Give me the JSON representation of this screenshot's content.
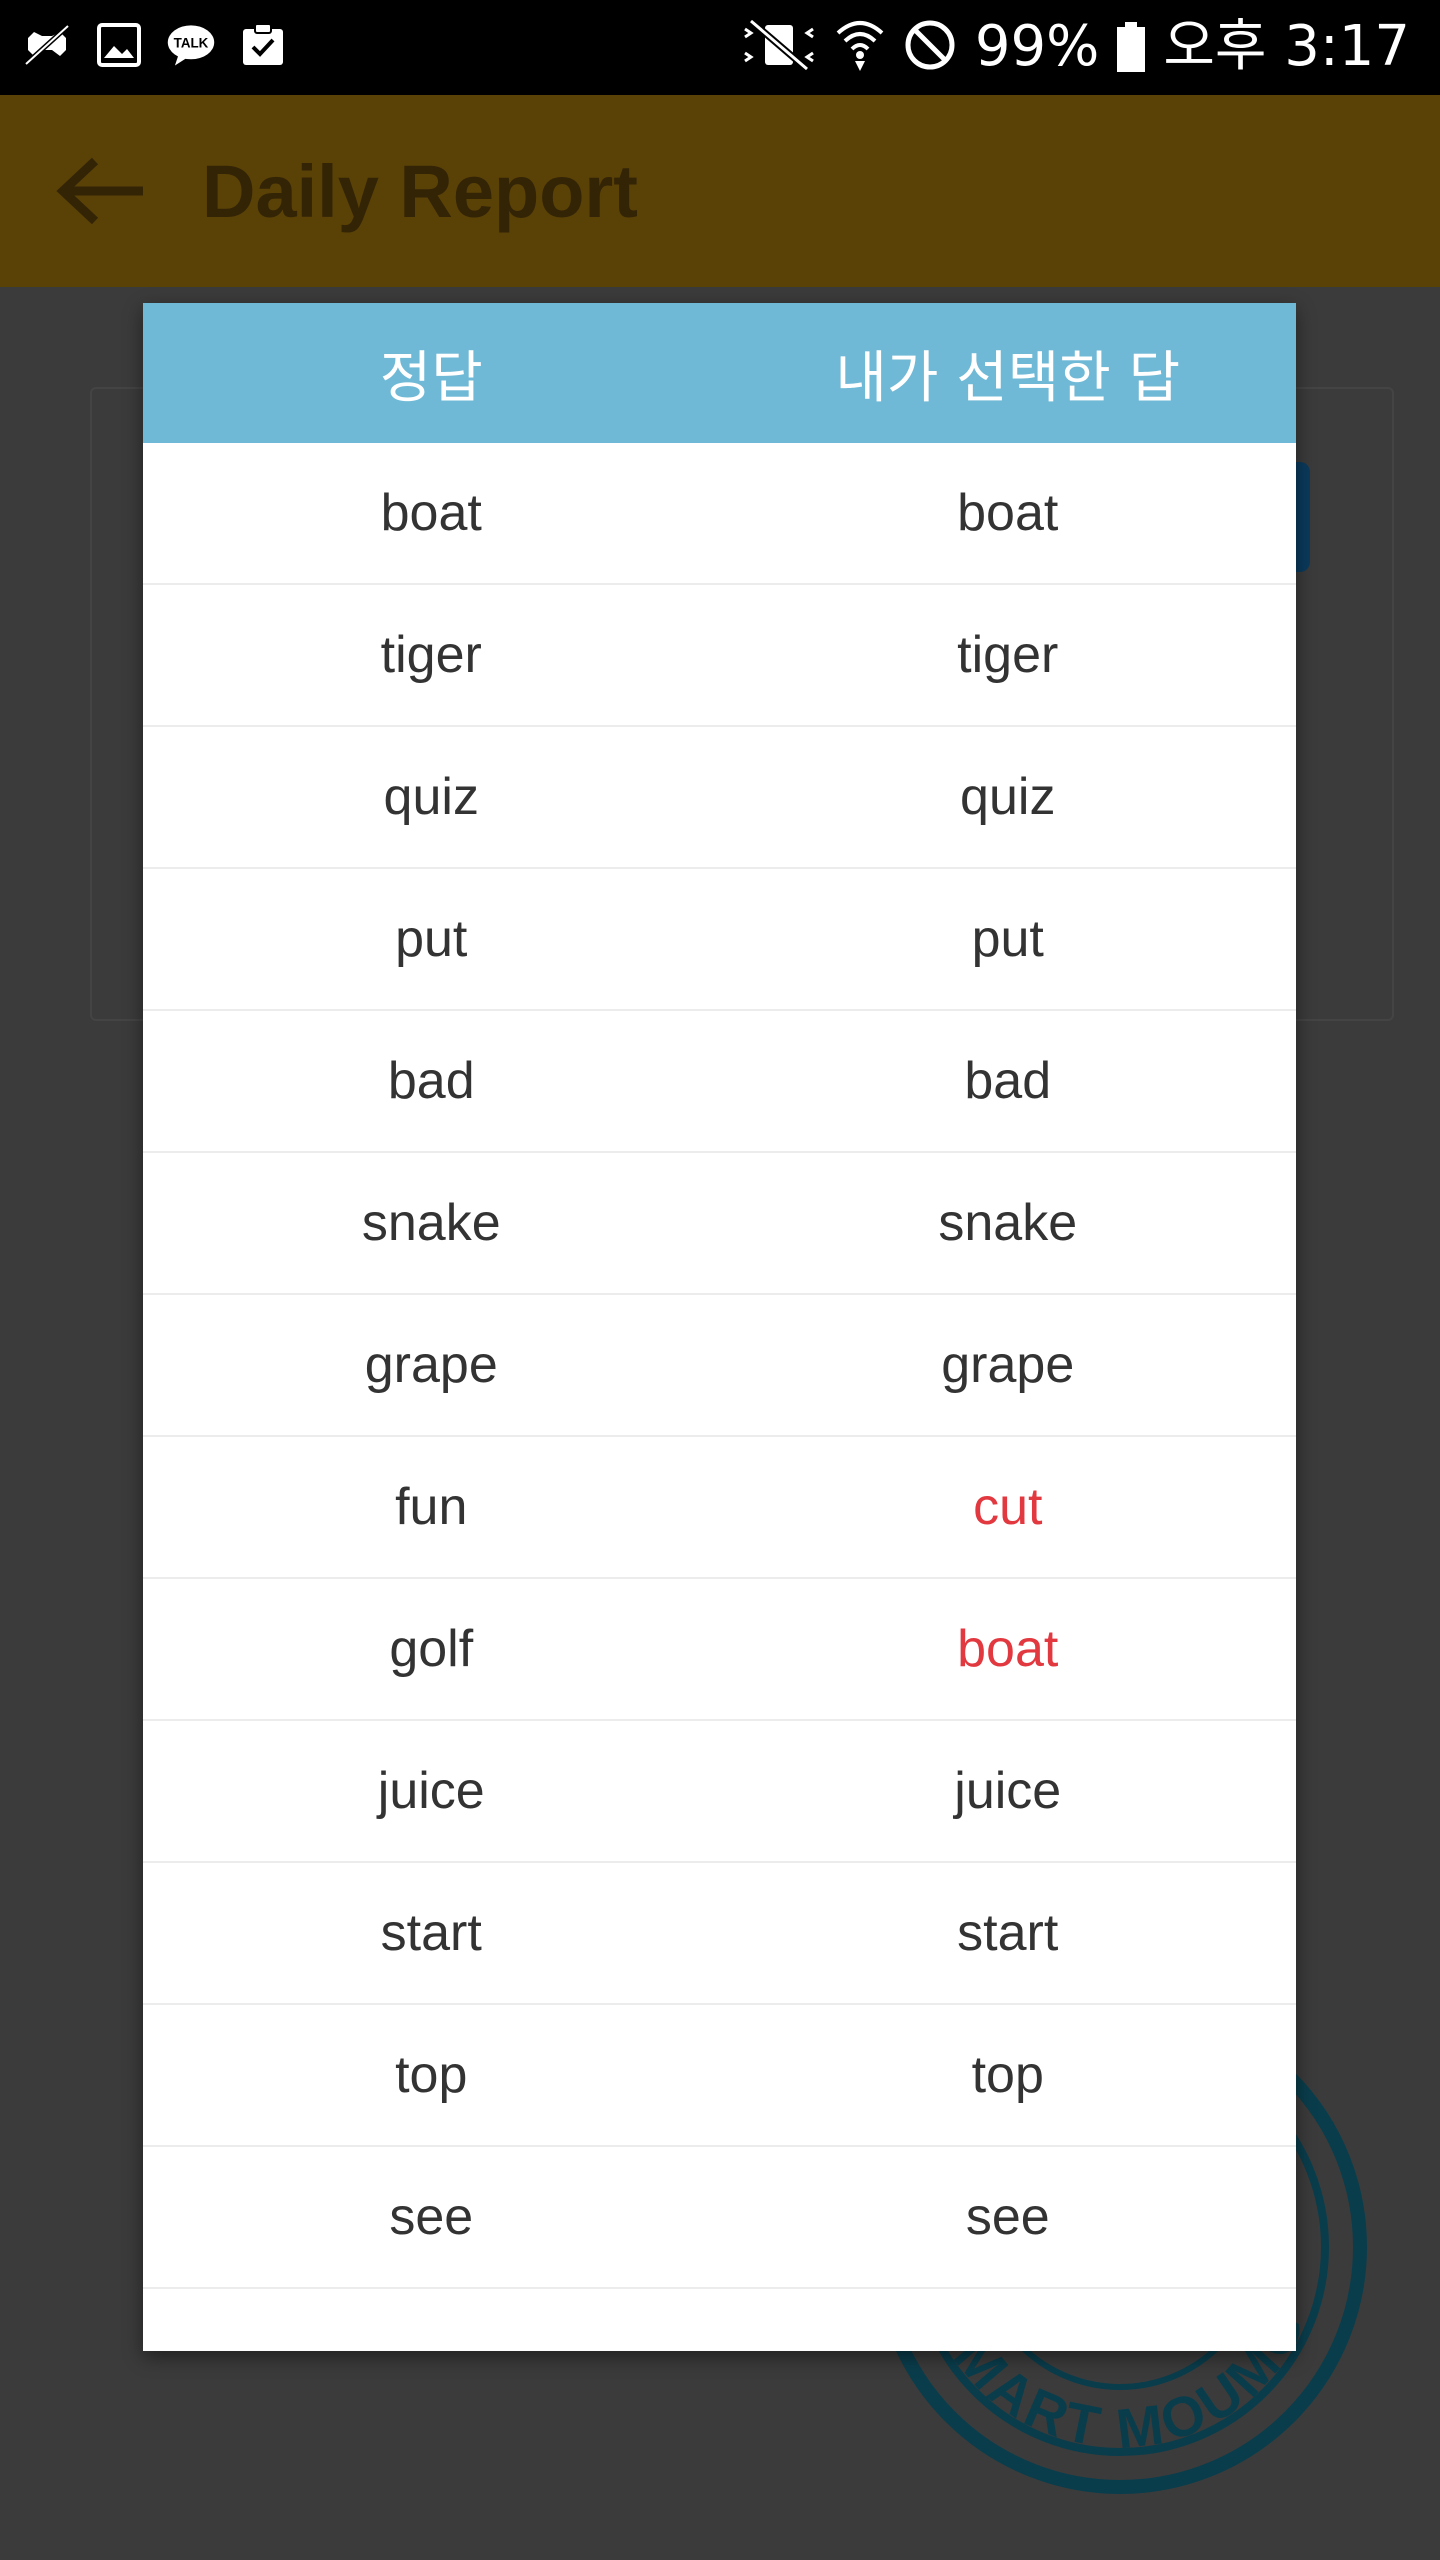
{
  "status_bar": {
    "left_icons": [
      "game-icon",
      "image-icon",
      "talk-icon",
      "clipboard-icon"
    ],
    "talk_label": "TALK",
    "right_icons": [
      "mute-vibrate-icon",
      "wifi-icon",
      "block-icon",
      "battery-icon"
    ],
    "battery_percent": "99%",
    "time": "오후 3:17"
  },
  "app_bar": {
    "title": "Daily Report",
    "back_icon": "arrow-left-icon"
  },
  "dialog": {
    "header": {
      "col_correct": "정답",
      "col_selected": "내가 선택한 답"
    },
    "rows": [
      {
        "correct": "boat",
        "selected": "boat",
        "is_wrong": false
      },
      {
        "correct": "tiger",
        "selected": "tiger",
        "is_wrong": false
      },
      {
        "correct": "quiz",
        "selected": "quiz",
        "is_wrong": false
      },
      {
        "correct": "put",
        "selected": "put",
        "is_wrong": false
      },
      {
        "correct": "bad",
        "selected": "bad",
        "is_wrong": false
      },
      {
        "correct": "snake",
        "selected": "snake",
        "is_wrong": false
      },
      {
        "correct": "grape",
        "selected": "grape",
        "is_wrong": false
      },
      {
        "correct": "fun",
        "selected": "cut",
        "is_wrong": true
      },
      {
        "correct": "golf",
        "selected": "boat",
        "is_wrong": true
      },
      {
        "correct": "juice",
        "selected": "juice",
        "is_wrong": false
      },
      {
        "correct": "start",
        "selected": "start",
        "is_wrong": false
      },
      {
        "correct": "top",
        "selected": "top",
        "is_wrong": false
      },
      {
        "correct": "see",
        "selected": "see",
        "is_wrong": false
      }
    ]
  },
  "colors": {
    "header_bg": "#6fb9d6",
    "wrong_text": "#e2383f",
    "normal_text": "#333333",
    "app_bar_dim": "#5a4106"
  },
  "background": {
    "stamp_text": "SMART MOUMG"
  }
}
